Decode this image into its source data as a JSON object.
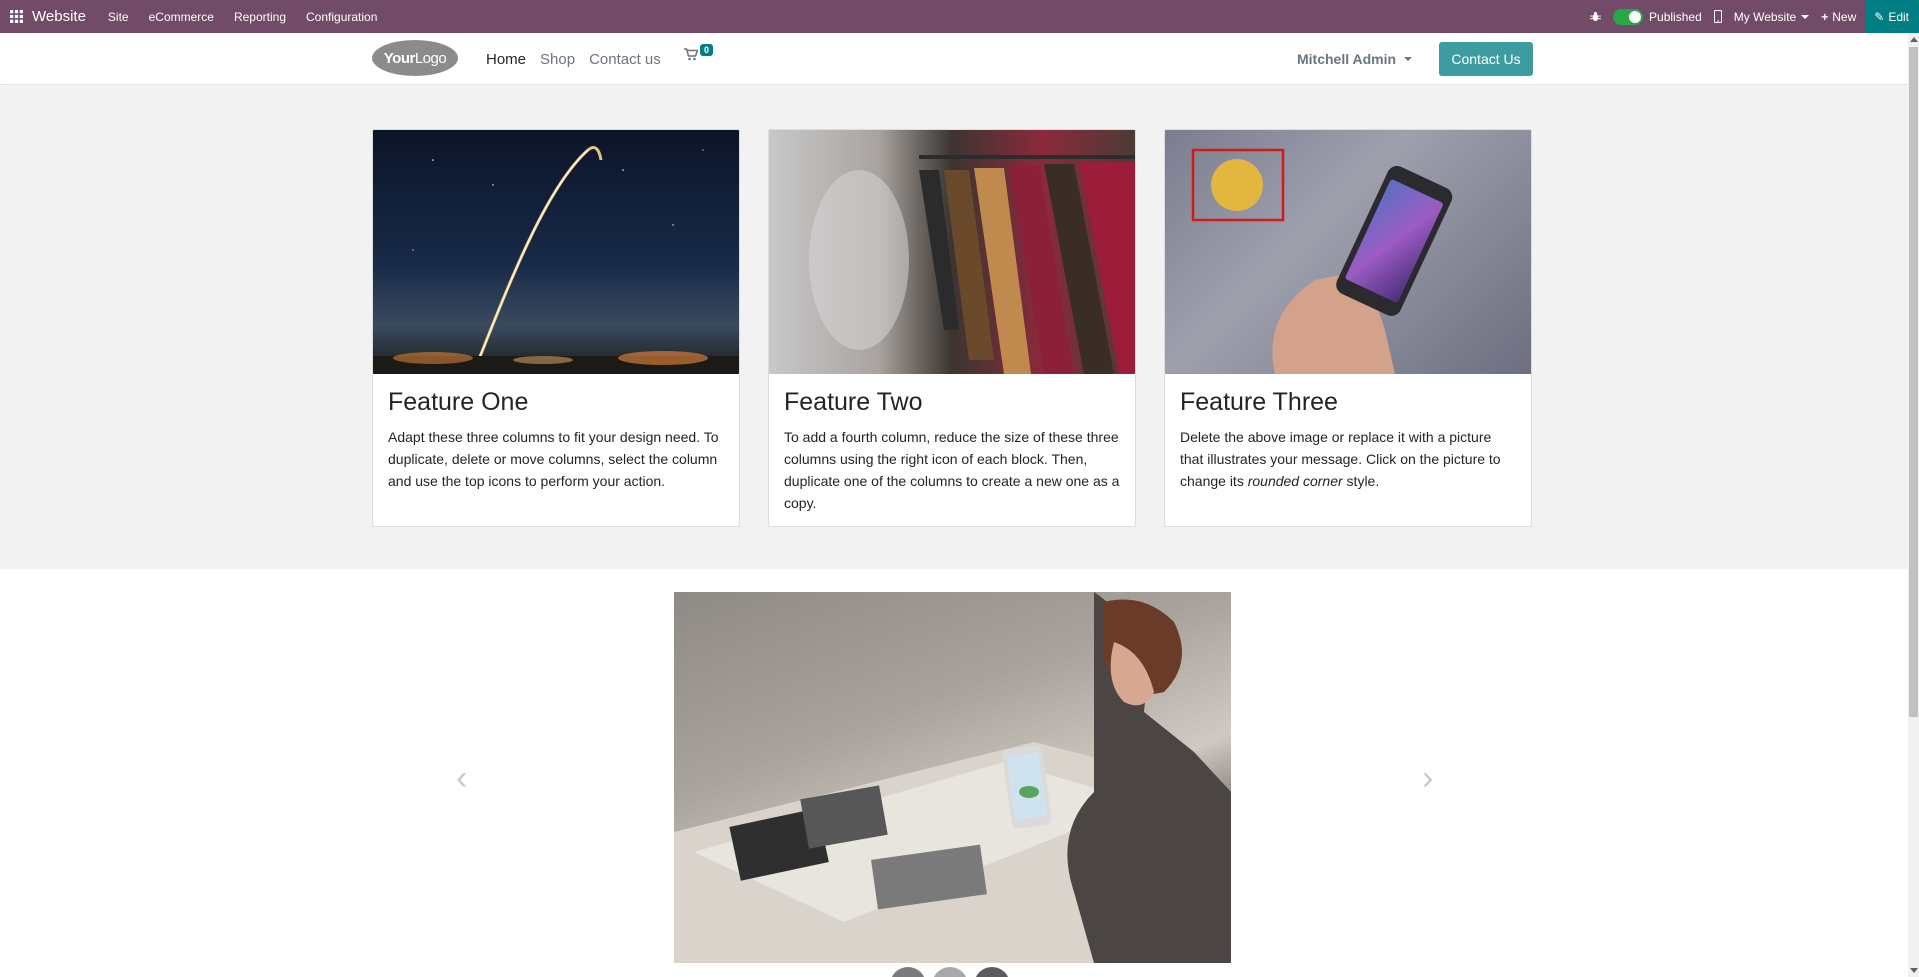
{
  "admin_bar": {
    "brand": "Website",
    "menu": [
      "Site",
      "eCommerce",
      "Reporting",
      "Configuration"
    ],
    "published_label": "Published",
    "website_selector": "My Website",
    "new_label": "New",
    "edit_label": "Edit"
  },
  "header": {
    "logo_text_bold": "Your",
    "logo_text": "Logo",
    "nav": [
      "Home",
      "Shop",
      "Contact us"
    ],
    "cart_count": "0",
    "user_name": "Mitchell Admin",
    "contact_button": "Contact Us"
  },
  "features": [
    {
      "title": "Feature One",
      "text": "Adapt these three columns to fit your design need. To duplicate, delete or move columns, select the column and use the top icons to perform your action."
    },
    {
      "title": "Feature Two",
      "text": "To add a fourth column, reduce the size of these three columns using the right icon of each block. Then, duplicate one of the columns to create a new one as a copy."
    },
    {
      "title": "Feature Three",
      "text_before": "Delete the above image or replace it with a picture that illustrates your message. Click on the picture to change its ",
      "text_em": "rounded corner",
      "text_after": " style."
    }
  ],
  "colors": {
    "admin_bar": "#714b67",
    "accent": "#3d9c9f",
    "edit": "#017e84"
  }
}
